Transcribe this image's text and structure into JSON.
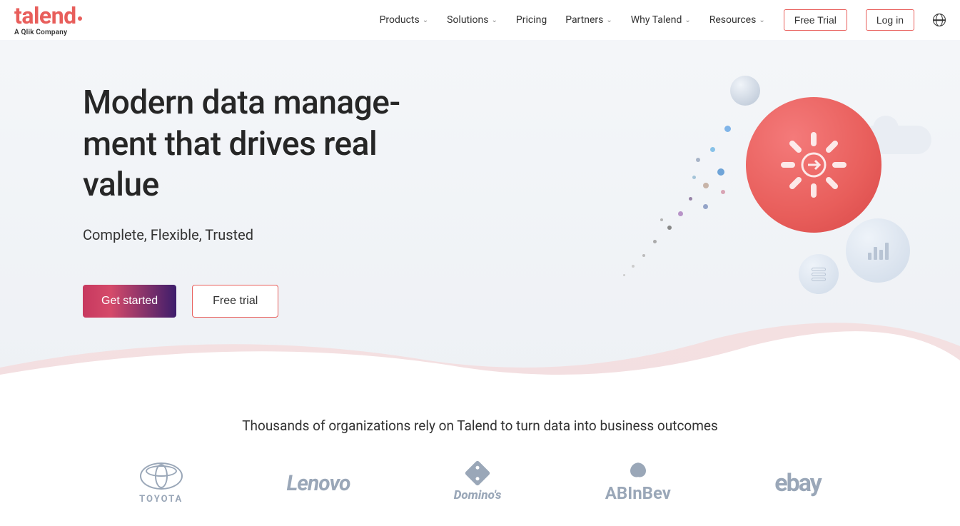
{
  "logo": {
    "text": "talend",
    "sub": "A Qlik Company"
  },
  "nav": {
    "items": [
      "Products",
      "Solutions",
      "Pricing",
      "Partners",
      "Why Talend",
      "Resources"
    ],
    "has_dropdown": [
      true,
      true,
      false,
      true,
      true,
      true
    ],
    "free_trial": "Free Trial",
    "log_in": "Log in"
  },
  "hero": {
    "title_l1": "Modern data manage-",
    "title_l2": "ment that drives real",
    "title_l3": "value",
    "subtitle": "Complete, Flexible, Trusted",
    "cta_primary": "Get started",
    "cta_secondary": "Free trial"
  },
  "social": {
    "headline": "Thousands of organizations rely on Talend to turn data into business outcomes",
    "logos": [
      "TOYOTA",
      "Lenovo",
      "Domino's",
      "ABInBev",
      "ebay"
    ]
  },
  "colors": {
    "brand": "#e85e5b",
    "dark": "#262626",
    "muted": "#9aa7b8"
  }
}
